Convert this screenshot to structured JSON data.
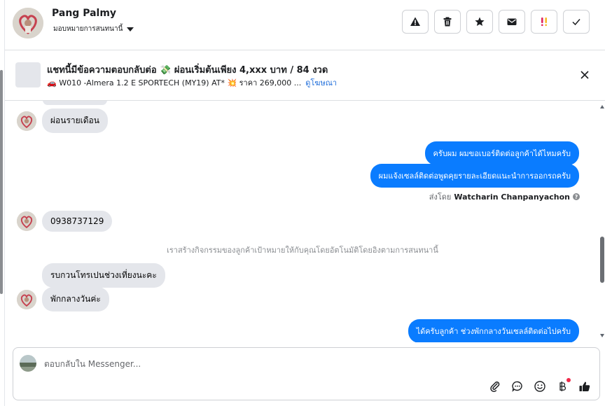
{
  "header": {
    "name": "Pang Palmy",
    "assign_label": "มอบหมายการสนทนานี้",
    "actions": [
      {
        "icon": "warning-icon"
      },
      {
        "icon": "trash-icon"
      },
      {
        "icon": "star-icon"
      },
      {
        "icon": "mail-icon"
      },
      {
        "icon": "priority-icon"
      },
      {
        "icon": "check-icon"
      }
    ]
  },
  "ad_banner": {
    "title": "แชทนี้มีข้อความตอบกลับต่อ 💸 ผ่อนเริ่มต้นเพียง 4,xxx บาท / 84 งวด",
    "subtitle": "🚗 W010 -Almera 1.2 E SPORTECH (MY19) AT* 💥 ราคา 269,000 ...",
    "link_text": "ดูโฆษณา"
  },
  "messages": [
    {
      "dir": "in",
      "text": "ผ่อนรายเดือน"
    },
    {
      "dir": "out",
      "text": "ครับผม ผมขอเบอร์ติดต่อลูกค้าได้ไหมครับ"
    },
    {
      "dir": "out",
      "text": "ผมแจ้งเซลล์ติดต่อพูดคุยรายละเอียดแนะนำการออกรถครับ"
    },
    {
      "dir": "in",
      "text": "0938737129"
    },
    {
      "dir": "in",
      "text": "รบกวนโทรเปนช่วงเที่ยงนะคะ"
    },
    {
      "dir": "in",
      "text": "พักกลางวันค่ะ"
    },
    {
      "dir": "out",
      "text": "ได้ครับลูกค้า ช่วงพักกลางวันเซลล์ติดต่อไปครับ"
    }
  ],
  "sent_by": {
    "prefix": "ส่งโดย",
    "agent": "Watcharin Chanpanyachon"
  },
  "system_note": "เราสร้างกิจกรรมของลูกค้าเป้าหมายให้กับคุณโดยอัตโนมัติโดยอิงตามการสนทนานี้",
  "composer": {
    "placeholder": "ตอบกลับใน Messenger...",
    "tools": [
      "paperclip-icon",
      "chat-bubble-icon",
      "emoji-icon",
      "baht-icon",
      "thumbs-up-icon"
    ],
    "thumbs_color": "#050505",
    "notice_color": "#f02849"
  },
  "colors": {
    "outgoing_bubble": "#0a7cff",
    "incoming_bubble": "#e4e6eb",
    "link": "#216fdb"
  }
}
